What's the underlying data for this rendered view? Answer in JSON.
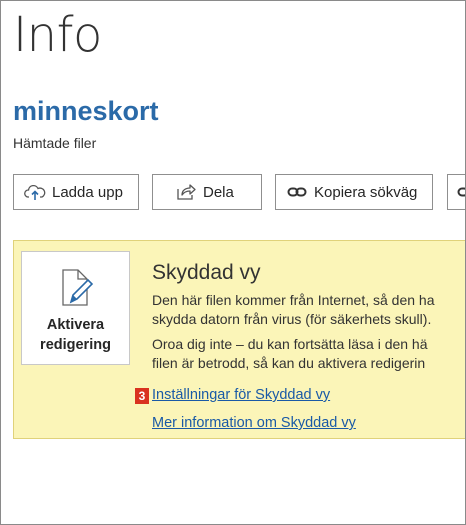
{
  "page": {
    "title": "Info",
    "document_name": "minneskort",
    "location": "Hämtade filer"
  },
  "toolbar": {
    "upload_label": "Ladda upp",
    "share_label": "Dela",
    "copy_path_label": "Kopiera sökväg"
  },
  "protected_view": {
    "enable_button_label": "Aktivera\nredigering",
    "title": "Skyddad vy",
    "paragraph1": "Den här filen kommer från Internet, så den ha\nskydda datorn från virus (för säkerhets skull).",
    "paragraph2": "Oroa dig inte – du kan fortsätta läsa i den hä\nfilen är betrodd, så kan du aktivera redigerin",
    "settings_link": "Inställningar för Skyddad vy",
    "more_info_link": "Mer information om Skyddad vy",
    "marker_number": "3",
    "marker_color": "#d9321f",
    "banner_color": "#fbf5b8",
    "link_color": "#1a5aa6"
  },
  "icons": {
    "upload": "cloud-upload-icon",
    "share": "share-icon",
    "copy": "link-icon",
    "enable_edit": "document-edit-icon"
  }
}
